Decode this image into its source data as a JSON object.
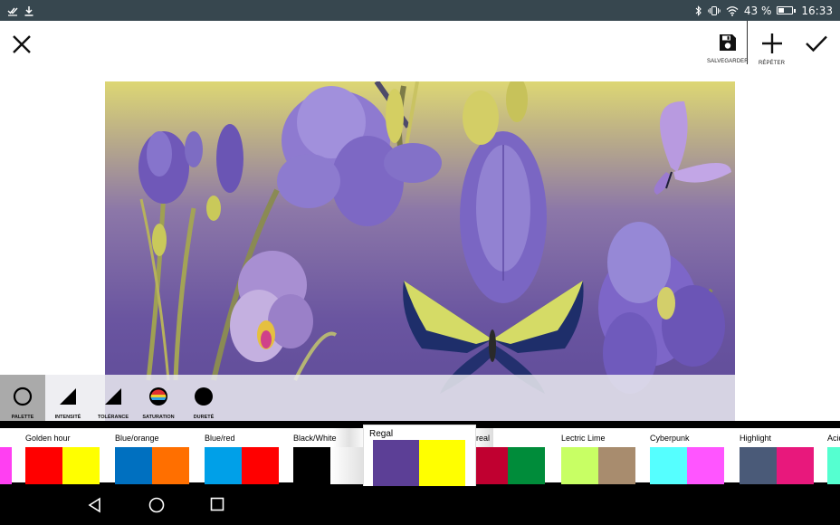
{
  "status_bar": {
    "battery_text": "43 %",
    "time": "16:33",
    "battery_level": 0.43
  },
  "toolbar": {
    "save_label": "SALVEGARDER",
    "repeat_label": "RÉPÉTER"
  },
  "tools": [
    {
      "label": "PALETTE",
      "icon": "ring-icon",
      "active": true
    },
    {
      "label": "INTENSITÉ",
      "icon": "triangle-icon",
      "active": false
    },
    {
      "label": "TOLÉRANCE",
      "icon": "triangle-icon",
      "active": false
    },
    {
      "label": "SATURATION",
      "icon": "saturation-icon",
      "active": false
    },
    {
      "label": "DURETÉ",
      "icon": "filled-circle-icon",
      "active": false
    }
  ],
  "palettes": [
    {
      "name": "",
      "colors": [
        "#ff3ff2"
      ]
    },
    {
      "name": "Golden hour",
      "colors": [
        "#ff0000",
        "#ffff00"
      ]
    },
    {
      "name": "Blue/orange",
      "colors": [
        "#0070c0",
        "#ff6f00"
      ]
    },
    {
      "name": "Blue/red",
      "colors": [
        "#00a0e8",
        "#ff0000"
      ]
    },
    {
      "name": "Black/White",
      "colors": [
        "#000000",
        "#ffffff"
      ]
    },
    {
      "name": "Regal",
      "colors": [
        "#5c3f96",
        "#ffff00"
      ],
      "selected": true
    },
    {
      "name": "ereal",
      "colors": [
        "#c00030",
        "#008c3a"
      ]
    },
    {
      "name": "Lectric Lime",
      "colors": [
        "#c8ff64",
        "#a88c6e"
      ]
    },
    {
      "name": "Cyberpunk",
      "colors": [
        "#55ffff",
        "#ff55ff"
      ]
    },
    {
      "name": "Highlight",
      "colors": [
        "#4a5a78",
        "#e8187c"
      ]
    },
    {
      "name": "Acid",
      "colors": [
        "#55ffd0"
      ]
    }
  ]
}
